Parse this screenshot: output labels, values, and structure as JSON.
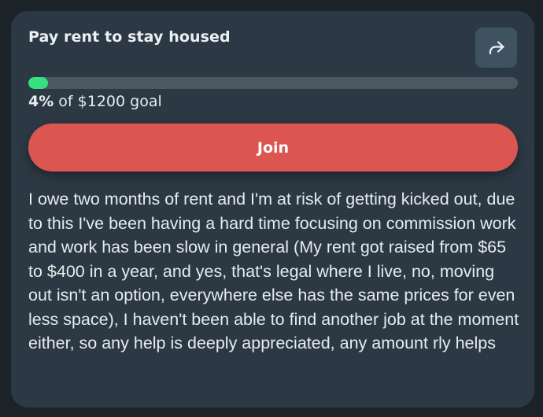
{
  "card": {
    "title": "Pay rent to stay housed",
    "share_icon": "share-arrow-icon",
    "progress": {
      "percent_label": "4%",
      "goal_suffix": " of $1200 goal",
      "fraction": 0.04,
      "fill_color": "#37e07f"
    },
    "join_label": "Join",
    "join_color": "#db5651",
    "description": "I owe two months of rent and I'm at risk of getting kicked out, due to this I've been having a hard time focusing on commission work and work has been slow in general (My rent got raised from $65 to $400 in a year, and yes, that's legal where I live, no, moving out isn't an option, everywhere else has the same prices for even less space), I haven't been able to find another job at the moment either, so any help is deeply appreciated, any amount rly helps"
  }
}
